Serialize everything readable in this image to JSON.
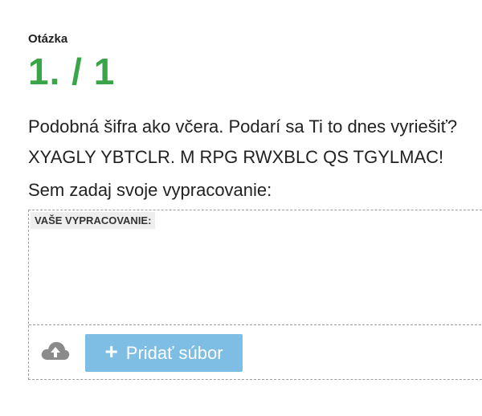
{
  "question": {
    "label": "Otázka",
    "number": "1. / 1"
  },
  "content": {
    "line1": "Podobná šifra ako včera. Podarí sa Ti to dnes vyriešiť?",
    "line2": "XYAGLY YBTCLR. M RPG RWXBLC QS TGYLMAC!",
    "line3": "Sem zadaj svoje vypracovanie:"
  },
  "answer": {
    "label": "VAŠE VYPRACOVANIE:",
    "value": ""
  },
  "upload": {
    "icon": "cloud-upload-icon",
    "button_icon": "plus-icon",
    "button_label": "Pridať súbor",
    "button_color": "#7ebde4"
  },
  "colors": {
    "accent": "#3aa548"
  }
}
